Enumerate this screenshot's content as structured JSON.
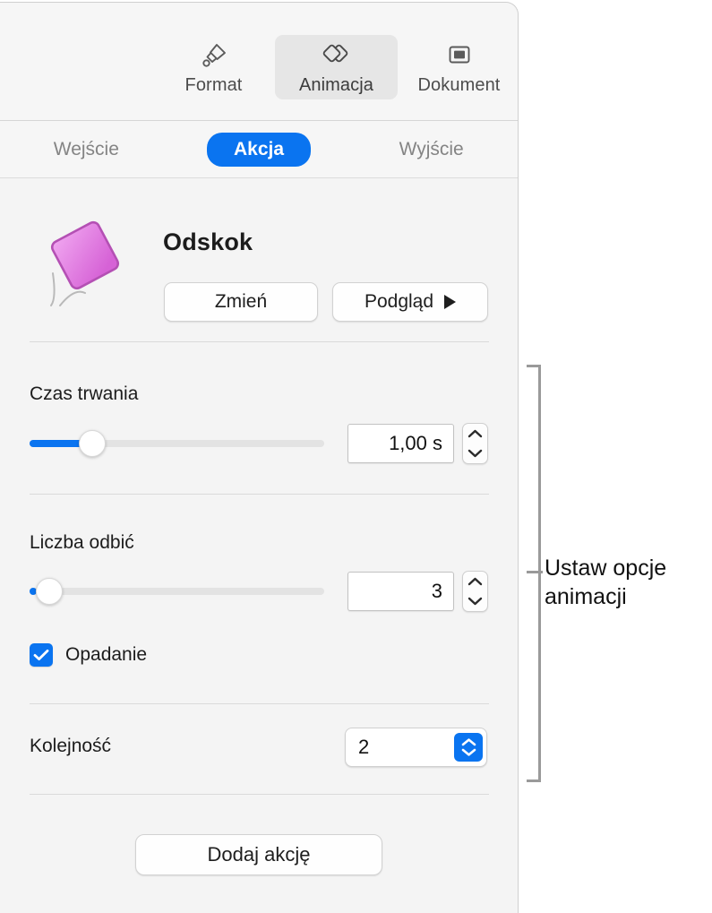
{
  "toolbar": {
    "items": [
      {
        "label": "Format",
        "icon": "paintbrush-icon",
        "selected": false
      },
      {
        "label": "Animacja",
        "icon": "animation-diamonds-icon",
        "selected": true
      },
      {
        "label": "Dokument",
        "icon": "document-rect-icon",
        "selected": false
      }
    ]
  },
  "tabs": [
    {
      "label": "Wejście",
      "active": false
    },
    {
      "label": "Akcja",
      "active": true
    },
    {
      "label": "Wyjście",
      "active": false
    }
  ],
  "effect": {
    "name": "Odskok",
    "thumb_icon": "bouncing-square-icon",
    "change_button": "Zmień",
    "preview_button": "Podgląd",
    "preview_icon": "play-icon"
  },
  "duration": {
    "label": "Czas trwania",
    "value": "1,00 s",
    "slider_percent": 20,
    "stepper_icon": "stepper-up-down-icon"
  },
  "bounces": {
    "label": "Liczba odbić",
    "value": "3",
    "slider_percent": 1,
    "stepper_icon": "stepper-up-down-icon"
  },
  "fall": {
    "label": "Opadanie",
    "checked": true,
    "check_icon": "checkmark-icon"
  },
  "order": {
    "label": "Kolejność",
    "value": "2",
    "arrows_icon": "chevron-up-down-icon"
  },
  "footer": {
    "add_action": "Dodaj akcję"
  },
  "callout": {
    "text": "Ustaw opcje animacji"
  },
  "colors": {
    "accent": "#0a74f0",
    "panel_bg": "#f4f4f4",
    "toolbar_bg": "#f6f6f6",
    "shape_fill": "#e87ae8"
  }
}
